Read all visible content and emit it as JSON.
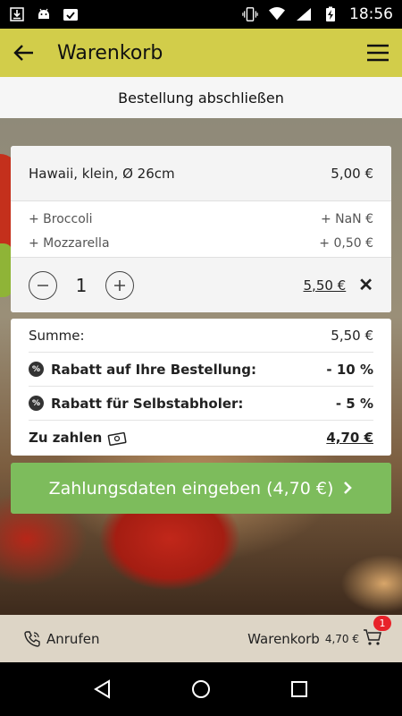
{
  "status_bar": {
    "time": "18:56",
    "icons": [
      "download-icon",
      "android-icon",
      "image-check-icon",
      "vibrate-icon",
      "wifi-icon",
      "signal-icon",
      "battery-charging-icon"
    ]
  },
  "app_bar": {
    "title": "Warenkorb",
    "back_icon": "arrow-left-icon",
    "menu_icon": "hamburger-icon",
    "color": "#d2cd4a"
  },
  "subheader": {
    "title": "Bestellung abschließen"
  },
  "cart_item": {
    "name": "Hawaii, klein, Ø 26cm",
    "price": "5,00 €",
    "extras": [
      {
        "name": "+ Broccoli",
        "price": "+ NaN €"
      },
      {
        "name": "+ Mozzarella",
        "price": "+ 0,50 €"
      }
    ],
    "quantity": "1",
    "line_total": "5,50 €",
    "remove_glyph": "✕"
  },
  "summary": {
    "subtotal_label": "Summe:",
    "subtotal_value": "5,50 €",
    "discounts": [
      {
        "label": "Rabatt auf Ihre Bestellung:",
        "value": "- 10 %",
        "badge": "%"
      },
      {
        "label": "Rabatt für Selbstabholer:",
        "value": "- 5 %",
        "badge": "%"
      }
    ],
    "total_label": "Zu zahlen",
    "total_value": "4,70 €"
  },
  "cta": {
    "label": "Zahlungsdaten eingeben (4,70 €)",
    "color": "#7dbc5c"
  },
  "bottom_bar": {
    "call_label": "Anrufen",
    "cart_label": "Warenkorb",
    "cart_total": "4,70 €",
    "cart_count": "1"
  }
}
